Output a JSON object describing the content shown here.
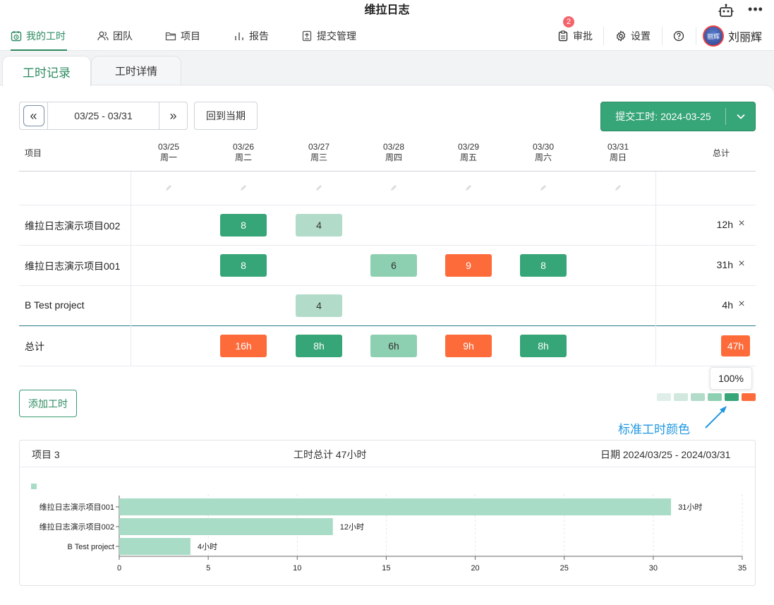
{
  "app": {
    "title": "维拉日志"
  },
  "nav": {
    "items": [
      {
        "label": "我的工时",
        "icon": "calendar-clock-icon",
        "active": true
      },
      {
        "label": "团队",
        "icon": "users-icon"
      },
      {
        "label": "项目",
        "icon": "folder-icon"
      },
      {
        "label": "报告",
        "icon": "bar-chart-icon"
      },
      {
        "label": "提交管理",
        "icon": "upload-file-icon"
      }
    ],
    "approve": {
      "label": "审批",
      "badge": "2"
    },
    "settings": {
      "label": "设置"
    },
    "user": {
      "name": "刘丽辉",
      "avatar_text": "丽辉"
    }
  },
  "tabs": [
    "工时记录",
    "工时详情"
  ],
  "toolbar": {
    "range": "03/25 - 03/31",
    "prev": "«",
    "next": "»",
    "today": "回到当期",
    "submit": "提交工时: 2024-03-25"
  },
  "table": {
    "project_header": "项目",
    "total_header": "总计",
    "days": [
      {
        "date": "03/25",
        "weekday": "周一"
      },
      {
        "date": "03/26",
        "weekday": "周二"
      },
      {
        "date": "03/27",
        "weekday": "周三"
      },
      {
        "date": "03/28",
        "weekday": "周四"
      },
      {
        "date": "03/29",
        "weekday": "周五"
      },
      {
        "date": "03/30",
        "weekday": "周六"
      },
      {
        "date": "03/31",
        "weekday": "周日"
      }
    ],
    "rows": [
      {
        "project": "维拉日志演示项目002",
        "hours": [
          null,
          "8",
          "4",
          null,
          null,
          null,
          null
        ],
        "levels": [
          0,
          5,
          3,
          0,
          0,
          0,
          0
        ],
        "total": "12h"
      },
      {
        "project": "维拉日志演示项目001",
        "hours": [
          null,
          "8",
          null,
          "6",
          "9",
          "8",
          null
        ],
        "levels": [
          0,
          5,
          0,
          4,
          6,
          5,
          0
        ],
        "total": "31h"
      },
      {
        "project": "B Test project",
        "hours": [
          null,
          null,
          "4",
          null,
          null,
          null,
          null
        ],
        "levels": [
          0,
          0,
          3,
          0,
          0,
          0,
          0
        ],
        "total": "4h"
      }
    ],
    "summary": {
      "label": "总计",
      "hours": [
        null,
        "16h",
        "8h",
        "6h",
        "9h",
        "8h",
        null
      ],
      "levels": [
        0,
        6,
        5,
        4,
        6,
        5,
        0
      ],
      "total": "47h"
    }
  },
  "add_button": "添加工时",
  "legend": {
    "tooltip": "100%",
    "note": "标准工时颜色",
    "colors": [
      "#e0eee8",
      "#d0e8dd",
      "#b2dcc9",
      "#8dd0b1",
      "#36a577",
      "#fd6b3b"
    ]
  },
  "summary_panel": {
    "projects": "项目 3",
    "total": "工时总计 47小时",
    "dates": "日期 2024/03/25 - 2024/03/31"
  },
  "chart_data": {
    "type": "bar",
    "orientation": "horizontal",
    "categories": [
      "维拉日志演示项目001",
      "维拉日志演示项目002",
      "B Test project"
    ],
    "values": [
      31,
      12,
      4
    ],
    "data_labels": [
      "31小时",
      "12小时",
      "4小时"
    ],
    "xlim": [
      0,
      35
    ],
    "xticks": [
      0,
      5,
      10,
      15,
      20,
      25,
      30,
      35
    ],
    "grid": true,
    "color": "#a8dcc6"
  }
}
